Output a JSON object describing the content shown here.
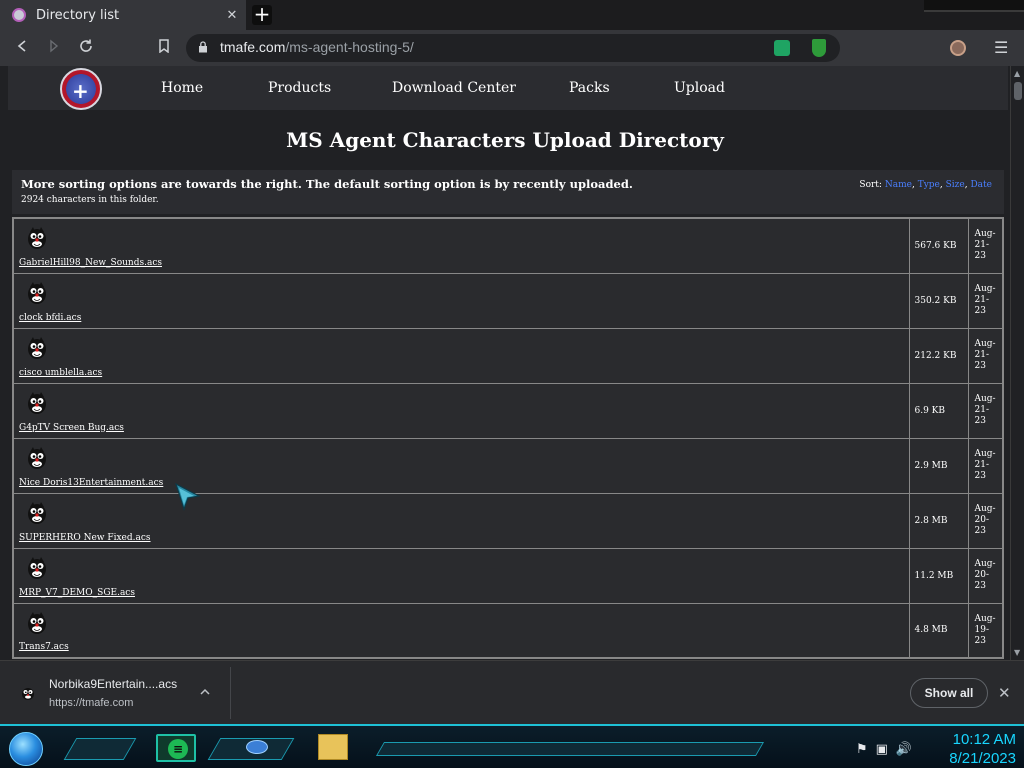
{
  "browser": {
    "tab_title": "Directory list",
    "tab_close": "✕",
    "new_tab": "+",
    "url_domain": "tmafe.com",
    "url_path": "/ms-agent-hosting-5/"
  },
  "site": {
    "nav": [
      "Home",
      "Products",
      "Download Center",
      "Packs",
      "Upload"
    ],
    "heading": "MS Agent Characters Upload Directory",
    "info_text": "More sorting options are towards the right. The default sorting option is by recently uploaded.",
    "count_text": "2924 characters in this folder.",
    "sort_label": "Sort:",
    "sort_options": [
      "Name",
      "Type",
      "Size",
      "Date"
    ]
  },
  "files": [
    {
      "name": "GabrielHill98_New_Sounds.acs",
      "size": "567.6 KB",
      "date": [
        "Aug-",
        "21-",
        "23"
      ]
    },
    {
      "name": "clock bfdi.acs",
      "size": "350.2 KB",
      "date": [
        "Aug-",
        "21-",
        "23"
      ]
    },
    {
      "name": "cisco umblella.acs",
      "size": "212.2 KB",
      "date": [
        "Aug-",
        "21-",
        "23"
      ]
    },
    {
      "name": "G4pTV Screen Bug.acs",
      "size": "6.9 KB",
      "date": [
        "Aug-",
        "21-",
        "23"
      ]
    },
    {
      "name": "Nice Doris13Entertainment.acs",
      "size": "2.9 MB",
      "date": [
        "Aug-",
        "21-",
        "23"
      ]
    },
    {
      "name": "SUPERHERO New Fixed.acs",
      "size": "2.8 MB",
      "date": [
        "Aug-",
        "20-",
        "23"
      ]
    },
    {
      "name": "MRP_V7_DEMO_SGE.acs",
      "size": "11.2 MB",
      "date": [
        "Aug-",
        "20-",
        "23"
      ]
    },
    {
      "name": "Trans7.acs",
      "size": "4.8 MB",
      "date": [
        "Aug-",
        "19-",
        "23"
      ]
    }
  ],
  "download": {
    "filename": "Norbika9Entertain....acs",
    "source": "https://tmafe.com",
    "show_all": "Show all",
    "close": "✕"
  },
  "taskbar": {
    "time": "10:12 AM",
    "date": "8/21/2023"
  }
}
